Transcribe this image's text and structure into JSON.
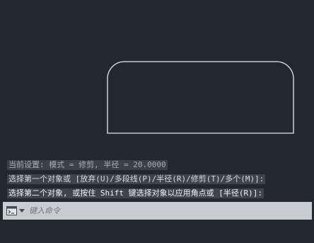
{
  "viewport": {
    "background": "#212830",
    "drawing_color": "#e6e8ea"
  },
  "command_history": [
    "当前设置: 模式 = 修剪, 半径 = 20.0000",
    "选择第一个对象或 [放弃(U)/多段线(P)/半径(R)/修剪(T)/多个(M)]:",
    "选择第二个对象, 或按住 Shift 键选择对象以应用角点或 [半径(R)]:"
  ],
  "command_line": {
    "placeholder": "键入命令",
    "value": "",
    "icon": "command-prompt-icon",
    "dropdown_icon": "chevron-down-icon"
  }
}
